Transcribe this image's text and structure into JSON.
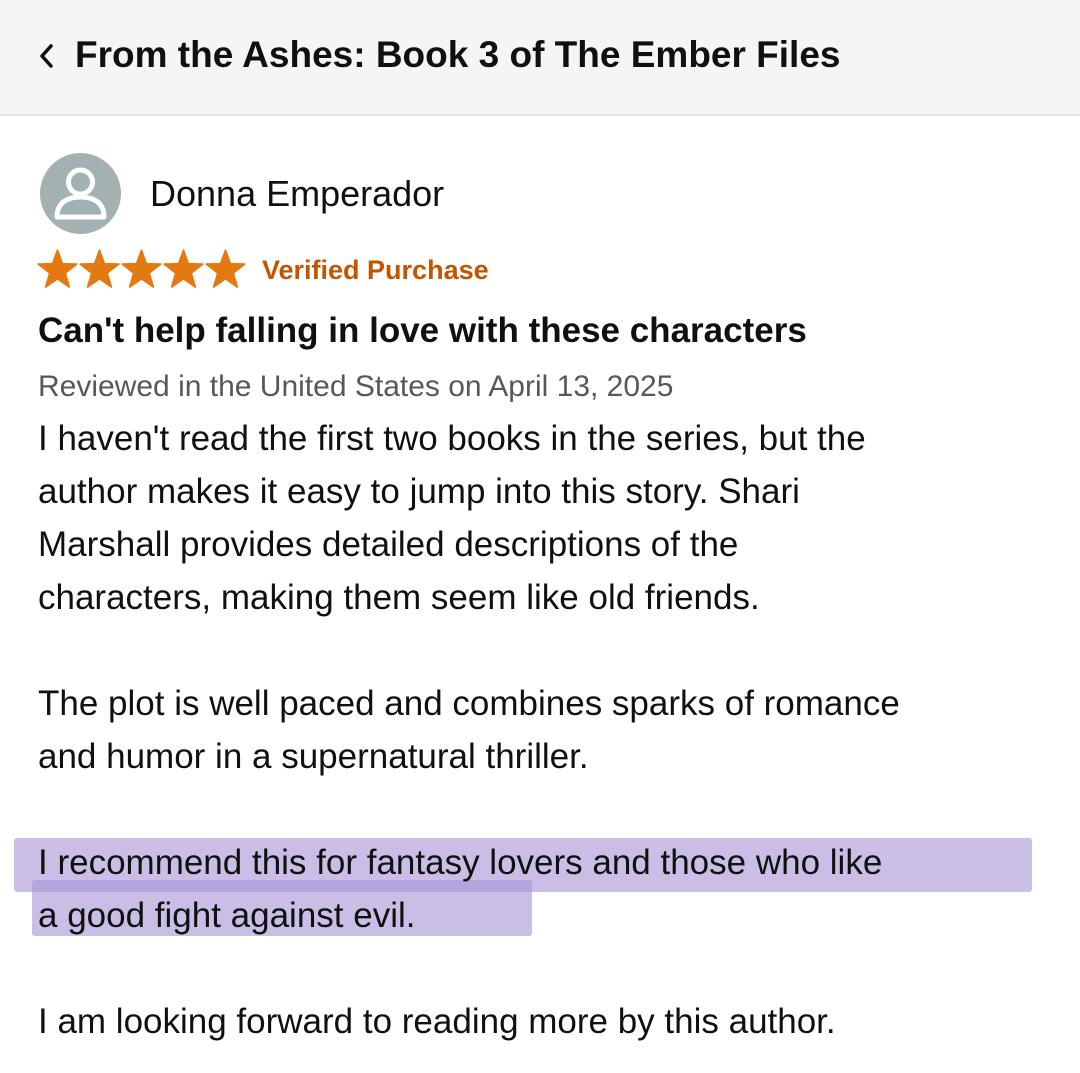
{
  "header": {
    "back_icon": "chevron-left-icon",
    "title": "From the Ashes: Book 3 of The Ember Files"
  },
  "review": {
    "avatar_icon": "user-avatar-icon",
    "reviewer_name": "Donna Emperador",
    "rating": 5,
    "rating_max": 5,
    "star_color": "#e47911",
    "verified_label": "Verified Purchase",
    "verified_color": "#c45500",
    "title": "Can't help falling in love with these characters",
    "meta": "Reviewed in the United States on April 13, 2025",
    "body": {
      "p1_lines": [
        "I haven't read the first two books in the series, but the",
        "author makes it easy to jump into this story. Shari",
        "Marshall provides detailed descriptions of the",
        "characters, making them seem like old friends."
      ],
      "p2_lines": [
        "The plot is well paced and combines sparks of romance",
        "and humor in a supernatural thriller."
      ],
      "p3_lines": [
        "I recommend this for fantasy lovers and those who like",
        "a good fight against evil."
      ],
      "p4_lines": [
        "I am looking forward to reading more by this author."
      ]
    },
    "highlight_color": "#aa96d7"
  }
}
